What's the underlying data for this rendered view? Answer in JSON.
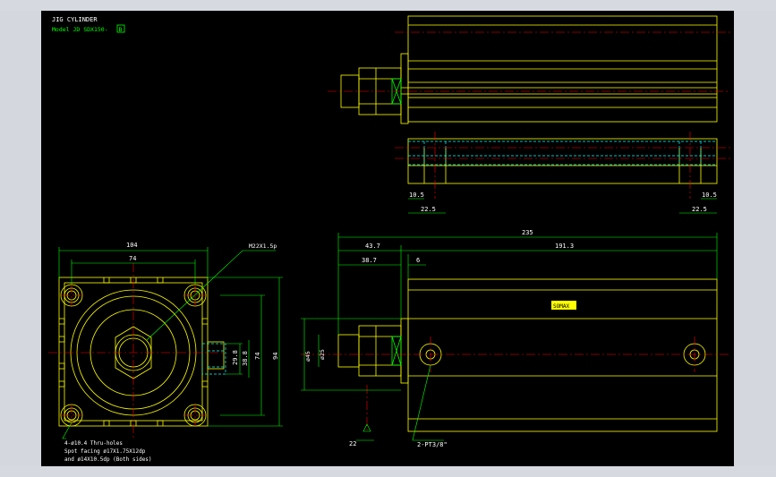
{
  "title": "JIG CYLINDER",
  "model_prefix": "Model JD SDX150-",
  "model_suffix": "B",
  "colors": {
    "background": "#000000",
    "outline": "#ffff00",
    "dimension": "#00ff00",
    "centerline": "#ff0000",
    "hidden": "#00ffff",
    "text": "#ffffff"
  },
  "dims": {
    "d104": "104",
    "d74": "74",
    "m22": "M22X1.5p",
    "d29_8": "29.8",
    "d38_8": "38.8",
    "d74v": "74",
    "d94": "94",
    "d235": "235",
    "d43_7": "43.7",
    "d191_3": "191.3",
    "d38_7": "38.7",
    "d6": "6",
    "d10_5_left": "10.5",
    "d22_5_left": "22.5",
    "d10_5_right": "10.5",
    "d22_5_right": "22.5",
    "d22": "22",
    "phi45": "ø45",
    "phi25": "ø25",
    "port": "2-PT3/8\""
  },
  "notes": {
    "holes_line1": "4-ø10.4 Thru-holes",
    "holes_line2": "Spot facing ø17X1.75X12dp",
    "holes_line3": "and ø14X10.5dp (Both sides)"
  },
  "nameplate": "SOMAX"
}
